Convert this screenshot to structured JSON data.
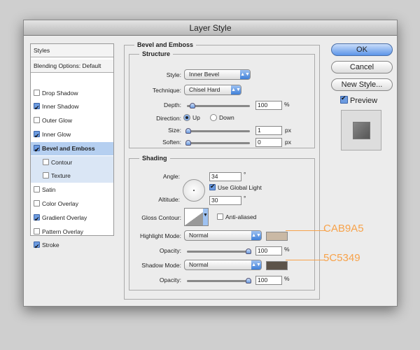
{
  "window": {
    "title": "Layer Style"
  },
  "sidebar": {
    "items": [
      {
        "label": "Styles",
        "type": "header"
      },
      {
        "label": "Blending Options: Default",
        "type": "header"
      },
      {
        "label": "Drop Shadow",
        "checked": false
      },
      {
        "label": "Inner Shadow",
        "checked": true
      },
      {
        "label": "Outer Glow",
        "checked": false
      },
      {
        "label": "Inner Glow",
        "checked": true
      },
      {
        "label": "Bevel and Emboss",
        "checked": true,
        "selected": true
      },
      {
        "label": "Contour",
        "checked": false,
        "sub": true
      },
      {
        "label": "Texture",
        "checked": false,
        "sub": true
      },
      {
        "label": "Satin",
        "checked": false
      },
      {
        "label": "Color Overlay",
        "checked": false
      },
      {
        "label": "Gradient Overlay",
        "checked": true
      },
      {
        "label": "Pattern Overlay",
        "checked": false
      },
      {
        "label": "Stroke",
        "checked": true
      }
    ]
  },
  "main": {
    "group_title": "Bevel and Emboss",
    "structure": {
      "title": "Structure",
      "style_label": "Style:",
      "style_value": "Inner Bevel",
      "technique_label": "Technique:",
      "technique_value": "Chisel Hard",
      "depth_label": "Depth:",
      "depth_value": "100",
      "depth_unit": "%",
      "direction_label": "Direction:",
      "direction_up": "Up",
      "direction_down": "Down",
      "direction_selected": "Up",
      "size_label": "Size:",
      "size_value": "1",
      "size_unit": "px",
      "soften_label": "Soften:",
      "soften_value": "0",
      "soften_unit": "px"
    },
    "shading": {
      "title": "Shading",
      "angle_label": "Angle:",
      "angle_value": "34",
      "degree": "°",
      "use_global_light": "Use Global Light",
      "use_global_light_checked": true,
      "altitude_label": "Altitude:",
      "altitude_value": "30",
      "gloss_contour_label": "Gloss Contour:",
      "anti_aliased": "Anti-aliased",
      "anti_aliased_checked": false,
      "highlight_mode_label": "Highlight Mode:",
      "highlight_mode_value": "Normal",
      "highlight_color": "#CAB9A5",
      "highlight_opacity_label": "Opacity:",
      "highlight_opacity": "100",
      "shadow_mode_label": "Shadow Mode:",
      "shadow_mode_value": "Normal",
      "shadow_color": "#5C5349",
      "shadow_opacity_label": "Opacity:",
      "shadow_opacity": "100",
      "percent": "%"
    }
  },
  "buttons": {
    "ok": "OK",
    "cancel": "Cancel",
    "new_style": "New Style...",
    "preview": "Preview",
    "preview_checked": true
  },
  "annotations": {
    "highlight": "CAB9A5",
    "shadow": "5C5349",
    "color": "#f7a24a"
  }
}
